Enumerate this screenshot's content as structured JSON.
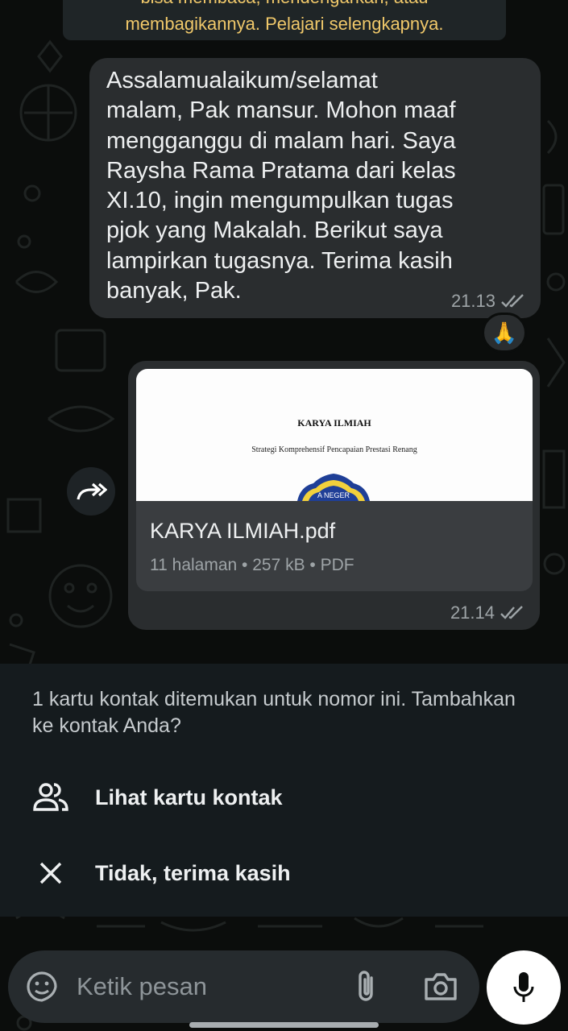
{
  "notice": {
    "line1": "bisa membaca, mendengarkan, atau",
    "line2": "membagikannya. Pelajari selengkapnya."
  },
  "messages": [
    {
      "text": "Assalamualaikum/selamat\nmalam, Pak mansur. Mohon maaf\nmengganggu di malam hari. Saya\nRaysha Rama Pratama dari kelas\nXI.10, ingin mengumpulkan tugas\npjok yang Makalah. Berikut saya\nlampirkan tugasnya. Terima kasih\nbanyak, Pak.",
      "time": "21.13",
      "reaction": "🙏"
    },
    {
      "document": {
        "preview_title": "KARYA ILMIAH",
        "preview_subtitle": "Strategi Komprehensif Pencapaian Prestasi Renang",
        "preview_logo_text": "A NEGER",
        "filename": "KARYA ILMIAH.pdf",
        "info": "11 halaman • 257 kB • PDF"
      },
      "time": "21.14"
    }
  ],
  "contact_panel": {
    "message": "1 kartu kontak ditemukan untuk nomor ini. Tambahkan ke kontak Anda?",
    "view_card_label": "Lihat kartu kontak",
    "dismiss_label": "Tidak, terima kasih"
  },
  "input": {
    "placeholder": "Ketik pesan"
  },
  "colors": {
    "background": "#0b0d0c",
    "bubble": "#2a2d2f",
    "notice_text": "#f0c86a",
    "panel": "#151b1e",
    "meta_text": "#9ea4a7"
  },
  "icons": [
    "double-check-icon",
    "forward-icon",
    "contacts-icon",
    "close-icon",
    "sticker-icon",
    "attach-icon",
    "camera-icon",
    "mic-icon"
  ]
}
